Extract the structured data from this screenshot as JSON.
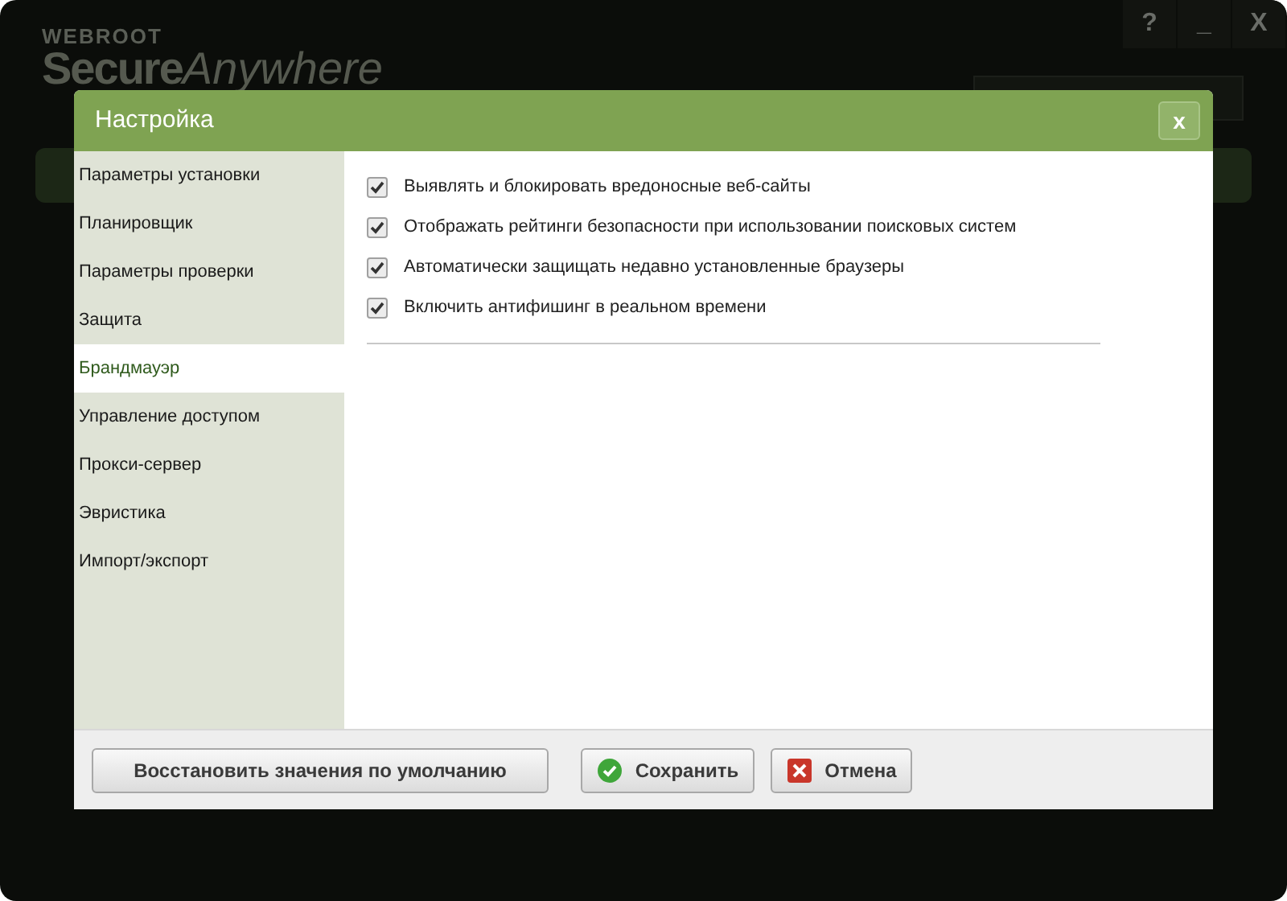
{
  "app": {
    "brand": "WEBROOT",
    "product_bold": "Secure",
    "product_light": "Anywhere",
    "window_controls": [
      "?",
      "_",
      "X"
    ]
  },
  "dialog": {
    "title": "Настройка",
    "close": "x",
    "sidebar": {
      "items": [
        {
          "label": "Параметры установки",
          "selected": false
        },
        {
          "label": "Планировщик",
          "selected": false
        },
        {
          "label": "Параметры проверки",
          "selected": false
        },
        {
          "label": "Защита",
          "selected": false
        },
        {
          "label": "Брандмауэр",
          "selected": true
        },
        {
          "label": "Управление доступом",
          "selected": false
        },
        {
          "label": "Прокси-сервер",
          "selected": false
        },
        {
          "label": "Эвристика",
          "selected": false
        },
        {
          "label": "Импорт/экспорт",
          "selected": false
        }
      ]
    },
    "options": [
      {
        "label": "Выявлять и блокировать вредоносные веб-сайты",
        "checked": true
      },
      {
        "label": "Отображать рейтинги безопасности при использовании поисковых систем",
        "checked": true
      },
      {
        "label": "Автоматически защищать недавно установленные браузеры",
        "checked": true
      },
      {
        "label": "Включить антифишинг в реальном времени",
        "checked": true
      }
    ],
    "buttons": [
      {
        "kind": "plain",
        "label": "Восстановить значения по умолчанию"
      },
      {
        "kind": "save",
        "label": "Сохранить"
      },
      {
        "kind": "cancel",
        "label": "Отмена"
      }
    ]
  }
}
